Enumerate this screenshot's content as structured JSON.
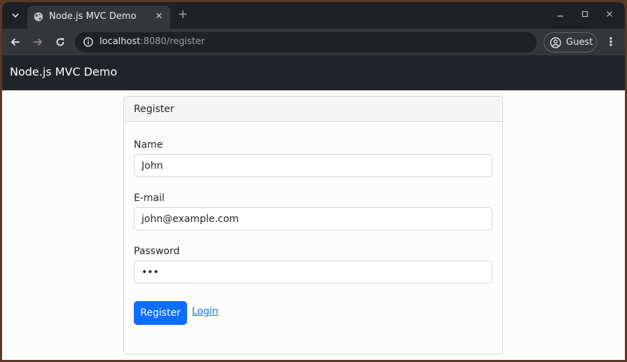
{
  "browser": {
    "tab": {
      "title": "Node.js MVC Demo"
    },
    "address": {
      "host": "localhost",
      "rest": ":8080/register"
    },
    "profile": {
      "label": "Guest"
    }
  },
  "page": {
    "brand": "Node.js MVC Demo",
    "card": {
      "title": "Register",
      "fields": {
        "name": {
          "label": "Name",
          "value": "John"
        },
        "email": {
          "label": "E-mail",
          "value": "john@example.com"
        },
        "password": {
          "label": "Password",
          "value": "•••"
        }
      },
      "register_label": "Register",
      "login_label": "Login"
    }
  },
  "colors": {
    "primary": "#0d6efd",
    "navbar": "#212529"
  }
}
